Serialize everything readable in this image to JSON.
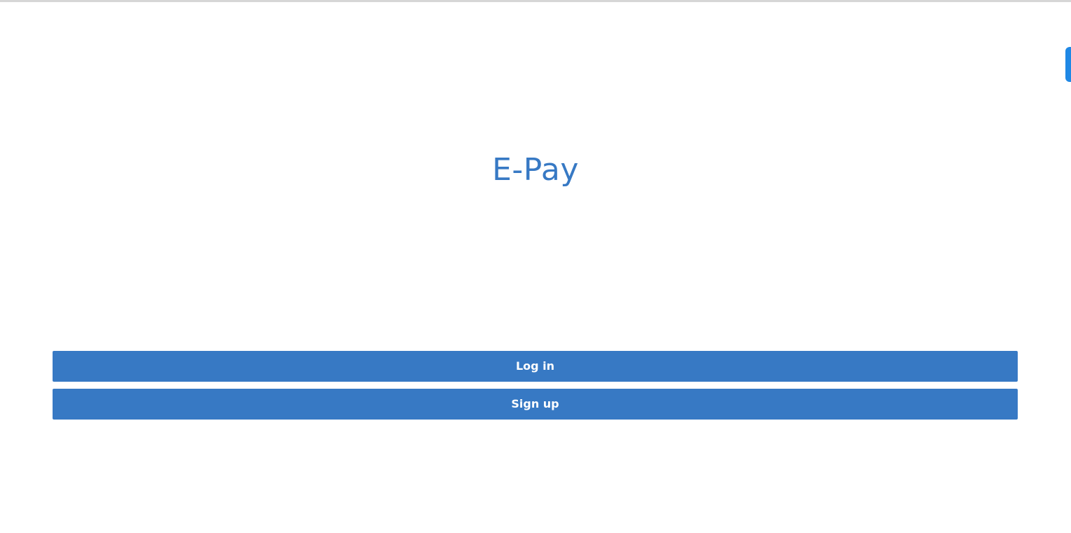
{
  "app": {
    "title": "E-Pay"
  },
  "actions": {
    "login_label": "Log in",
    "signup_label": "Sign up"
  },
  "colors": {
    "primary": "#3779c4",
    "title": "#3779c4",
    "side_tab": "#1f88e5"
  }
}
